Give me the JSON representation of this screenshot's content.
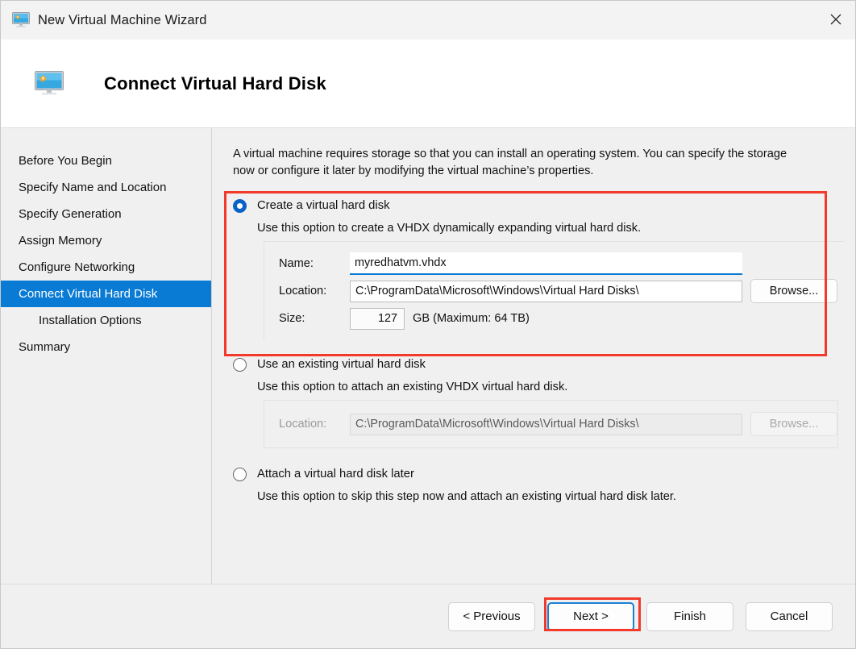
{
  "window": {
    "title": "New Virtual Machine Wizard",
    "title_icon": "virtual-machine-monitor-icon",
    "close_icon": "close-icon"
  },
  "header": {
    "title": "Connect Virtual Hard Disk",
    "icon": "virtual-machine-monitor-icon"
  },
  "sidebar": {
    "items": [
      {
        "label": "Before You Begin",
        "active": false,
        "indent": false
      },
      {
        "label": "Specify Name and Location",
        "active": false,
        "indent": false
      },
      {
        "label": "Specify Generation",
        "active": false,
        "indent": false
      },
      {
        "label": "Assign Memory",
        "active": false,
        "indent": false
      },
      {
        "label": "Configure Networking",
        "active": false,
        "indent": false
      },
      {
        "label": "Connect Virtual Hard Disk",
        "active": true,
        "indent": false
      },
      {
        "label": "Installation Options",
        "active": false,
        "indent": true
      },
      {
        "label": "Summary",
        "active": false,
        "indent": false
      }
    ]
  },
  "main": {
    "intro": "A virtual machine requires storage so that you can install an operating system. You can specify the storage now or configure it later by modifying the virtual machine’s properties.",
    "options": [
      {
        "label": "Create a virtual hard disk",
        "description": "Use this option to create a VHDX dynamically expanding virtual hard disk.",
        "selected": true,
        "enabled": true,
        "fields": {
          "name_label": "Name:",
          "name_value": "myredhatvm.vhdx",
          "location_label": "Location:",
          "location_value": "C:\\ProgramData\\Microsoft\\Windows\\Virtual Hard Disks\\",
          "browse_label": "Browse...",
          "size_label": "Size:",
          "size_value": "127",
          "size_unit": "GB (Maximum: 64 TB)"
        }
      },
      {
        "label": "Use an existing virtual hard disk",
        "description": "Use this option to attach an existing VHDX virtual hard disk.",
        "selected": false,
        "enabled": false,
        "fields": {
          "location_label": "Location:",
          "location_value": "C:\\ProgramData\\Microsoft\\Windows\\Virtual Hard Disks\\",
          "browse_label": "Browse..."
        }
      },
      {
        "label": "Attach a virtual hard disk later",
        "description": "Use this option to skip this step now and attach an existing virtual hard disk later.",
        "selected": false,
        "enabled": true
      }
    ]
  },
  "footer": {
    "previous_label": "< Previous",
    "next_label": "Next >",
    "finish_label": "Finish",
    "cancel_label": "Cancel"
  },
  "highlights": {
    "accent_red": "#f2392c",
    "accent_blue": "#0a7bd4",
    "selection_blue": "#0a62c7"
  }
}
